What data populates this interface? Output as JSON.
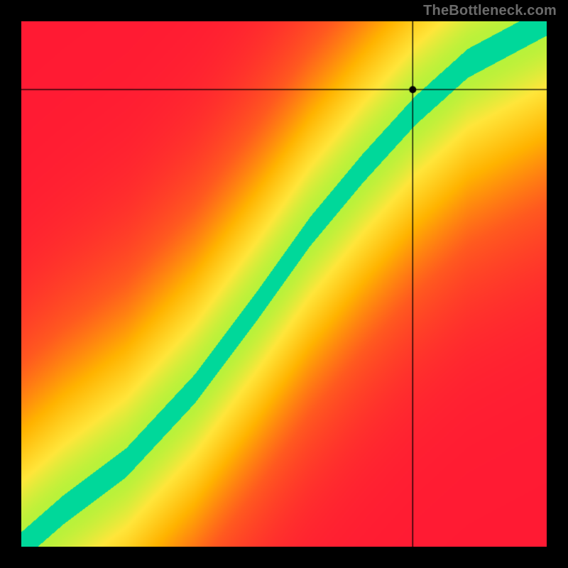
{
  "watermark": "TheBottleneck.com",
  "chart_data": {
    "type": "heatmap",
    "title": "",
    "xlabel": "",
    "ylabel": "",
    "xlim": [
      0,
      1
    ],
    "ylim": [
      0,
      1
    ],
    "marker": {
      "x": 0.745,
      "y": 0.87
    },
    "crosshair": {
      "x": 0.745,
      "y": 0.87
    },
    "ideal_curve_control_points": [
      {
        "x": 0.0,
        "y": 0.0
      },
      {
        "x": 0.08,
        "y": 0.07
      },
      {
        "x": 0.2,
        "y": 0.16
      },
      {
        "x": 0.33,
        "y": 0.3
      },
      {
        "x": 0.45,
        "y": 0.46
      },
      {
        "x": 0.55,
        "y": 0.6
      },
      {
        "x": 0.65,
        "y": 0.72
      },
      {
        "x": 0.75,
        "y": 0.83
      },
      {
        "x": 0.85,
        "y": 0.92
      },
      {
        "x": 1.0,
        "y": 1.0
      }
    ],
    "band_half_width": 0.055,
    "color_stops": [
      {
        "t": 0.0,
        "color": "#ff1a33"
      },
      {
        "t": 0.25,
        "color": "#ff5a1f"
      },
      {
        "t": 0.5,
        "color": "#ffb300"
      },
      {
        "t": 0.72,
        "color": "#ffe63a"
      },
      {
        "t": 0.86,
        "color": "#b8f23a"
      },
      {
        "t": 0.95,
        "color": "#3ce06e"
      },
      {
        "t": 1.0,
        "color": "#00d89a"
      }
    ]
  }
}
